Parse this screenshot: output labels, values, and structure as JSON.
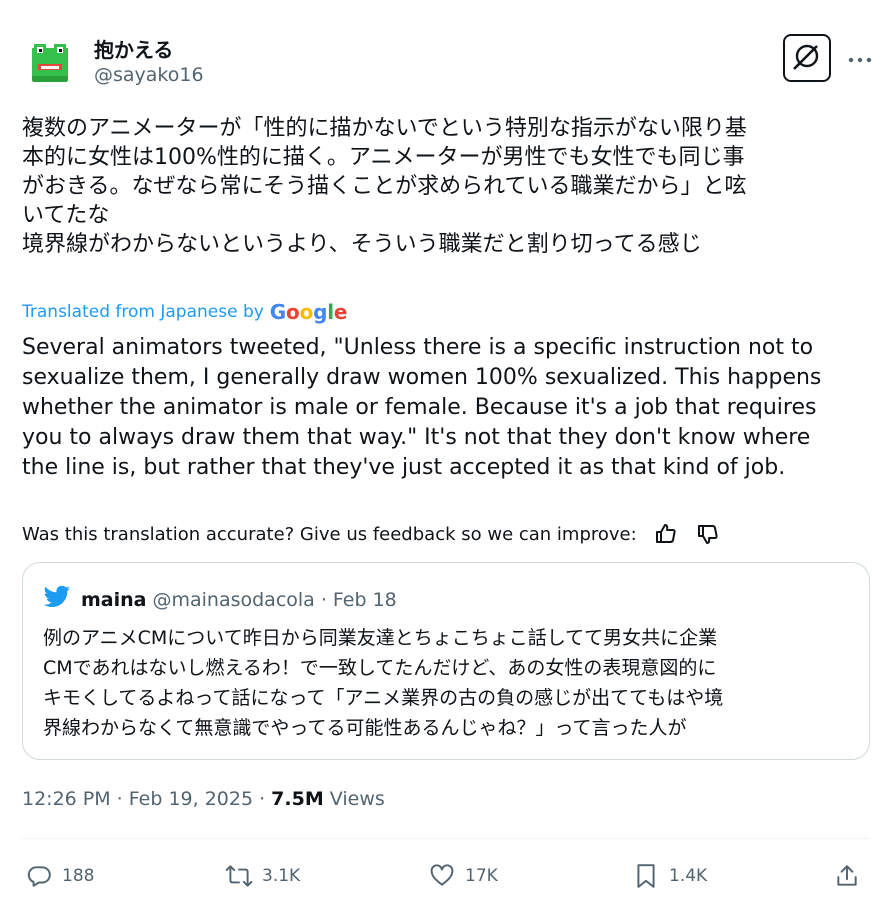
{
  "author": {
    "name": "抱かえる",
    "handle": "@sayako16"
  },
  "original_lines": [
    "複数のアニメーターが「性的に描かないでという特別な指示がない限り基",
    "本的に女性は100%性的に描く。アニメーターが男性でも女性でも同じ事",
    "がおきる。なぜなら常にそう描くことが求められている職業だから」と呟",
    "いてたな",
    "境界線がわからないというより、そういう職業だと割り切ってる感じ"
  ],
  "translated_label": "Translated from Japanese by",
  "translator": "Google",
  "translation_lines": [
    "Several animators tweeted, \"Unless there is a specific instruction not to",
    "sexualize them, I generally draw women 100% sexualized. This happens",
    "whether the animator is male or female. Because it's a job that requires",
    "you to always draw them that way.\" It's not that they don't know where",
    "the line is, but rather that they've just accepted it as that kind of job."
  ],
  "feedback_prompt": "Was this translation accurate? Give us feedback so we can improve:",
  "quote": {
    "name": "maina",
    "handle": "@mainasodacola",
    "date": "· Feb 18",
    "lines": [
      "例のアニメCMについて昨日から同業友達とちょこちょこ話してて男女共に企業",
      "CMであれはないし燃えるわ！で一致してたんだけど、あの女性の表現意図的に",
      "キモくしてるよねって話になって「アニメ業界の古の負の感じが出ててもはや境",
      "界線わからなくて無意識でやってる可能性あるんじゃね？」って言った人が"
    ]
  },
  "meta": {
    "timestamp": "12:26 PM · Feb 19, 2025 · ",
    "views_count": "7.5M",
    "views_label": " Views"
  },
  "actions": {
    "replies": "188",
    "reposts": "3.1K",
    "likes": "17K",
    "bookmarks": "1.4K"
  },
  "icons": [
    "grok-icon",
    "more-icon",
    "thumbs-up-icon",
    "thumbs-down-icon",
    "twitter-bird-icon",
    "reply-icon",
    "repost-icon",
    "like-icon",
    "bookmark-icon",
    "share-icon"
  ],
  "colors": {
    "link_blue": "#1d9bf0",
    "secondary_text": "#536471",
    "frog_green": "#34c04a"
  }
}
